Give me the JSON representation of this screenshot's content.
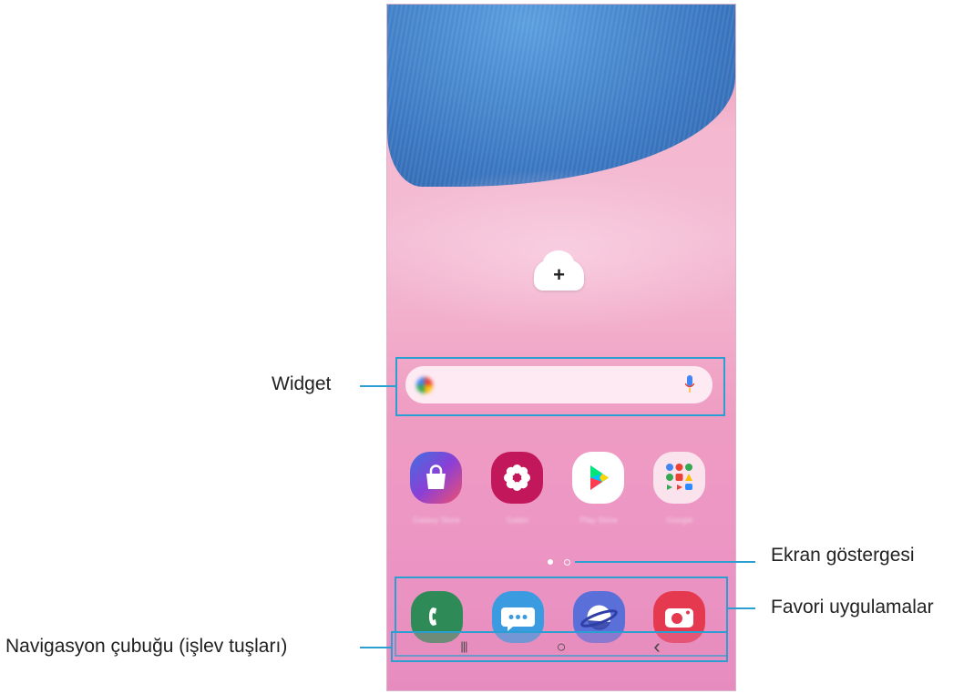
{
  "callouts": {
    "widget": "Widget",
    "page_indicator": "Ekran göstergesi",
    "favorites": "Favori uygulamalar",
    "navigation_bar": "Navigasyon çubuğu (işlev tuşları)"
  },
  "home_screen": {
    "add_widget_symbol": "+",
    "apps": [
      {
        "icon": "galaxy-store-icon",
        "color": "#5b4fcf"
      },
      {
        "icon": "gallery-icon",
        "color": "#c2185b"
      },
      {
        "icon": "play-store-icon",
        "color": "#ffffff"
      },
      {
        "icon": "google-folder-icon",
        "color": "#ffffff"
      }
    ],
    "dock": [
      {
        "icon": "phone-icon",
        "color": "#2e8b57"
      },
      {
        "icon": "messages-icon",
        "color": "#3a9be0"
      },
      {
        "icon": "internet-icon",
        "color": "#5a6fd8"
      },
      {
        "icon": "camera-icon",
        "color": "#e53950"
      }
    ],
    "pages": {
      "current": 1,
      "total": 2
    }
  },
  "nav": {
    "recents": "|||",
    "home": "○",
    "back": "‹"
  },
  "colors": {
    "callout_blue": "#2b9fd1",
    "wallpaper_pink": "#f2afcb",
    "fur_blue": "#3b78c2"
  }
}
